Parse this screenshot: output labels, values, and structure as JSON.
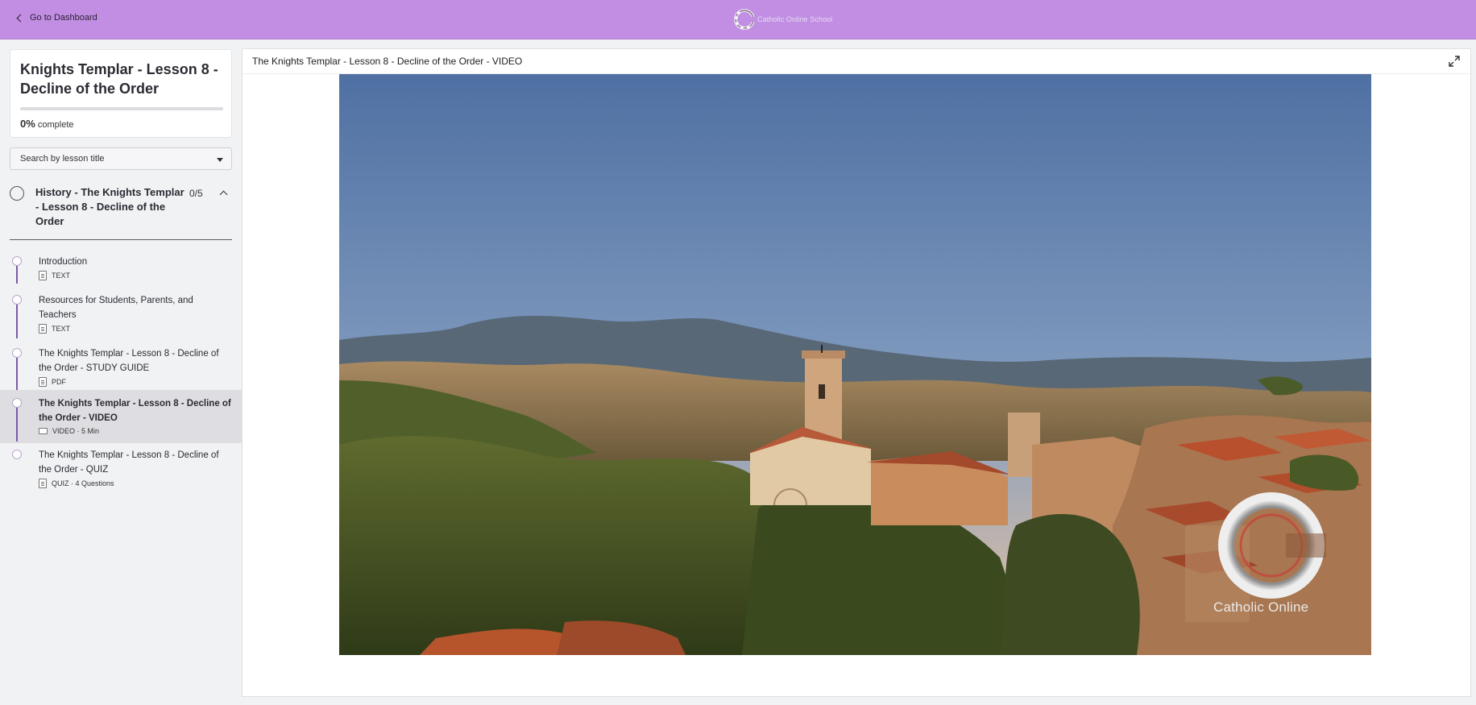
{
  "topbar": {
    "back_label": "Go to Dashboard",
    "brand_text": "Catholic Online School"
  },
  "course": {
    "title": "Knights Templar - Lesson 8 - Decline of the Order",
    "progress_percent": 0,
    "progress_value": "0%",
    "progress_label": "complete"
  },
  "search": {
    "placeholder": "Search by lesson title"
  },
  "section": {
    "title": "History - The Knights Templar - Lesson 8 - Decline of the Order",
    "count": "0/5"
  },
  "lessons": [
    {
      "title": "Introduction",
      "type": "TEXT",
      "icon": "text-doc-icon"
    },
    {
      "title": "Resources for Students, Parents, and Teachers",
      "type": "TEXT",
      "icon": "text-doc-icon"
    },
    {
      "title": "The Knights Templar - Lesson 8 - Decline of the Order - STUDY GUIDE",
      "type": "PDF",
      "icon": "pdf-doc-icon"
    },
    {
      "title": "The Knights Templar - Lesson 8 - Decline of the Order - VIDEO",
      "type": "VIDEO · 5 Min",
      "icon": "video-icon",
      "active": true
    },
    {
      "title": "The Knights Templar - Lesson 8 - Decline of the Order - QUIZ",
      "type": "QUIZ · 4 Questions",
      "icon": "quiz-icon"
    }
  ],
  "main": {
    "title": "The Knights Templar - Lesson 8 - Decline of the Order - VIDEO",
    "watermark": "Catholic Online"
  },
  "colors": {
    "topbar": "#c18ee3",
    "accent": "#7a4fa8"
  }
}
